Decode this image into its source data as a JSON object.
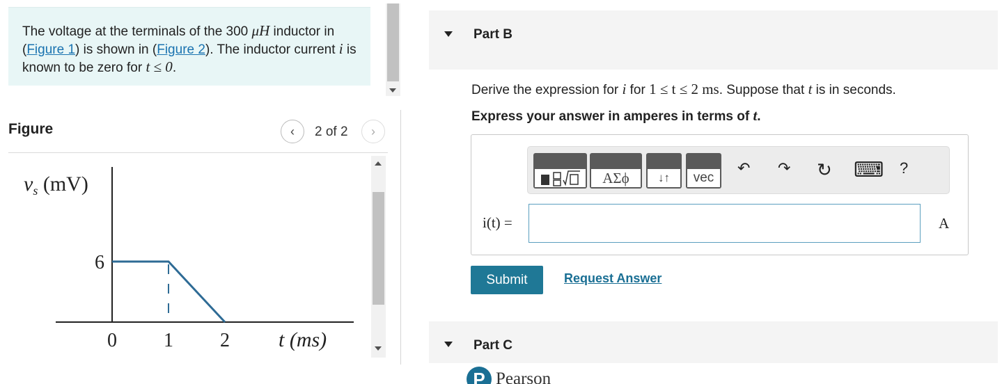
{
  "problem": {
    "text_1": "The voltage at the terminals of the 300 ",
    "text_mu": "μH",
    "text_2": " inductor in (",
    "link_fig1": "Figure 1",
    "text_3": ") is shown in (",
    "link_fig2": "Figure 2",
    "text_4": "). The inductor current ",
    "var_i": "i",
    "text_5": " is known to be zero for ",
    "condition": "t ≤ 0",
    "text_6": "."
  },
  "figure": {
    "label": "Figure",
    "counter": "2 of 2",
    "prev_glyph": "‹",
    "next_glyph": "›"
  },
  "chart_data": {
    "type": "line",
    "ylabel_var": "v",
    "ylabel_sub": "s",
    "ylabel_unit": " (mV)",
    "xlabel": "t (ms)",
    "x": [
      0,
      1,
      2
    ],
    "y": [
      6,
      6,
      0
    ],
    "x_ticks": [
      "0",
      "1",
      "2"
    ],
    "y_ticks": [
      "6"
    ],
    "xlim": [
      0,
      4.2
    ],
    "ylim": [
      0,
      8.4
    ],
    "line_color": "#2e6b95"
  },
  "partB": {
    "title": "Part B",
    "q_1": "Derive the expression for ",
    "q_i": "i",
    "q_2": " for ",
    "q_range": "1 ≤ t ≤ 2 ms",
    "q_3": ". Suppose that ",
    "q_t": "t",
    "q_4": " is in seconds.",
    "instr_1": "Express your answer in amperes in terms of ",
    "instr_t": "t",
    "instr_2": ".",
    "lhs": "i(t) =",
    "input_value": "",
    "unit": "A",
    "submit": "Submit",
    "request": "Request Answer"
  },
  "toolbar": {
    "templates_icon": "templates-icon",
    "greek_label": "ΑΣϕ",
    "arrows_label": "↓↑",
    "vec_label": "vec",
    "undo_glyph": "↶",
    "redo_glyph": "↷",
    "reset_glyph": "↻",
    "keyboard_glyph": "⌨",
    "help_glyph": "?"
  },
  "partC": {
    "title": "Part C"
  },
  "footer": {
    "logo_letter": "P",
    "brand": "Pearson"
  },
  "colors": {
    "accent": "#1f7896",
    "link": "#1a6f94",
    "problem_bg": "#e8f6f6"
  }
}
